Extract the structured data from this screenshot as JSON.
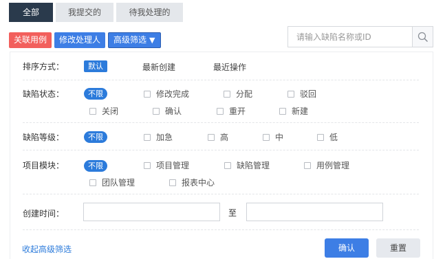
{
  "tabs": [
    "全部",
    "我提交的",
    "待我处理的"
  ],
  "toolbar": {
    "link_case": "关联用例",
    "change_handler": "修改处理人",
    "advanced_filter": "高级筛选",
    "dropdown_arrow": "▼"
  },
  "search": {
    "placeholder": "请输入缺陷名称或ID",
    "icon": "search-icon"
  },
  "sort": {
    "label": "排序方式：",
    "selected": "默认",
    "options": [
      "最新创建",
      "最近操作"
    ]
  },
  "status": {
    "label": "缺陷状态：",
    "selected": "不限",
    "options": [
      "修改完成",
      "分配",
      "驳回",
      "关闭",
      "确认",
      "重开",
      "新建"
    ]
  },
  "level": {
    "label": "缺陷等级：",
    "selected": "不限",
    "options": [
      "加急",
      "高",
      "中",
      "低"
    ]
  },
  "module": {
    "label": "项目模块：",
    "selected": "不限",
    "options": [
      "项目管理",
      "缺陷管理",
      "用例管理",
      "团队管理",
      "报表中心"
    ]
  },
  "created": {
    "label": "创建时间：",
    "separator": "至",
    "start_value": "",
    "end_value": ""
  },
  "footer": {
    "collapse": "收起高级筛选",
    "confirm": "确认",
    "reset": "重置"
  },
  "colors": {
    "tab_active": "#2a3a4c",
    "red_button": "#f25f5c",
    "blue_button": "#3d7ee5",
    "pill": "#2c7bdb"
  }
}
